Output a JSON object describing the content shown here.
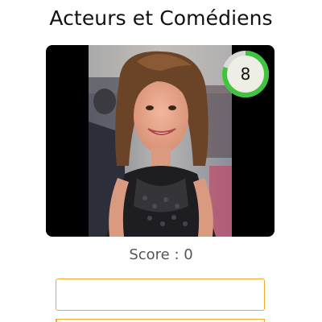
{
  "header": {
    "title": "Acteurs et Comédiens"
  },
  "quiz": {
    "timer_value": "8",
    "timer_fraction": 0.8,
    "score_text": "Score : 0",
    "answer_value": ""
  },
  "colors": {
    "accent": "#f0a830",
    "timer_ring": "#3ec43e",
    "timer_track": "#d9d9d9",
    "timer_fill": "#eeeee4"
  }
}
